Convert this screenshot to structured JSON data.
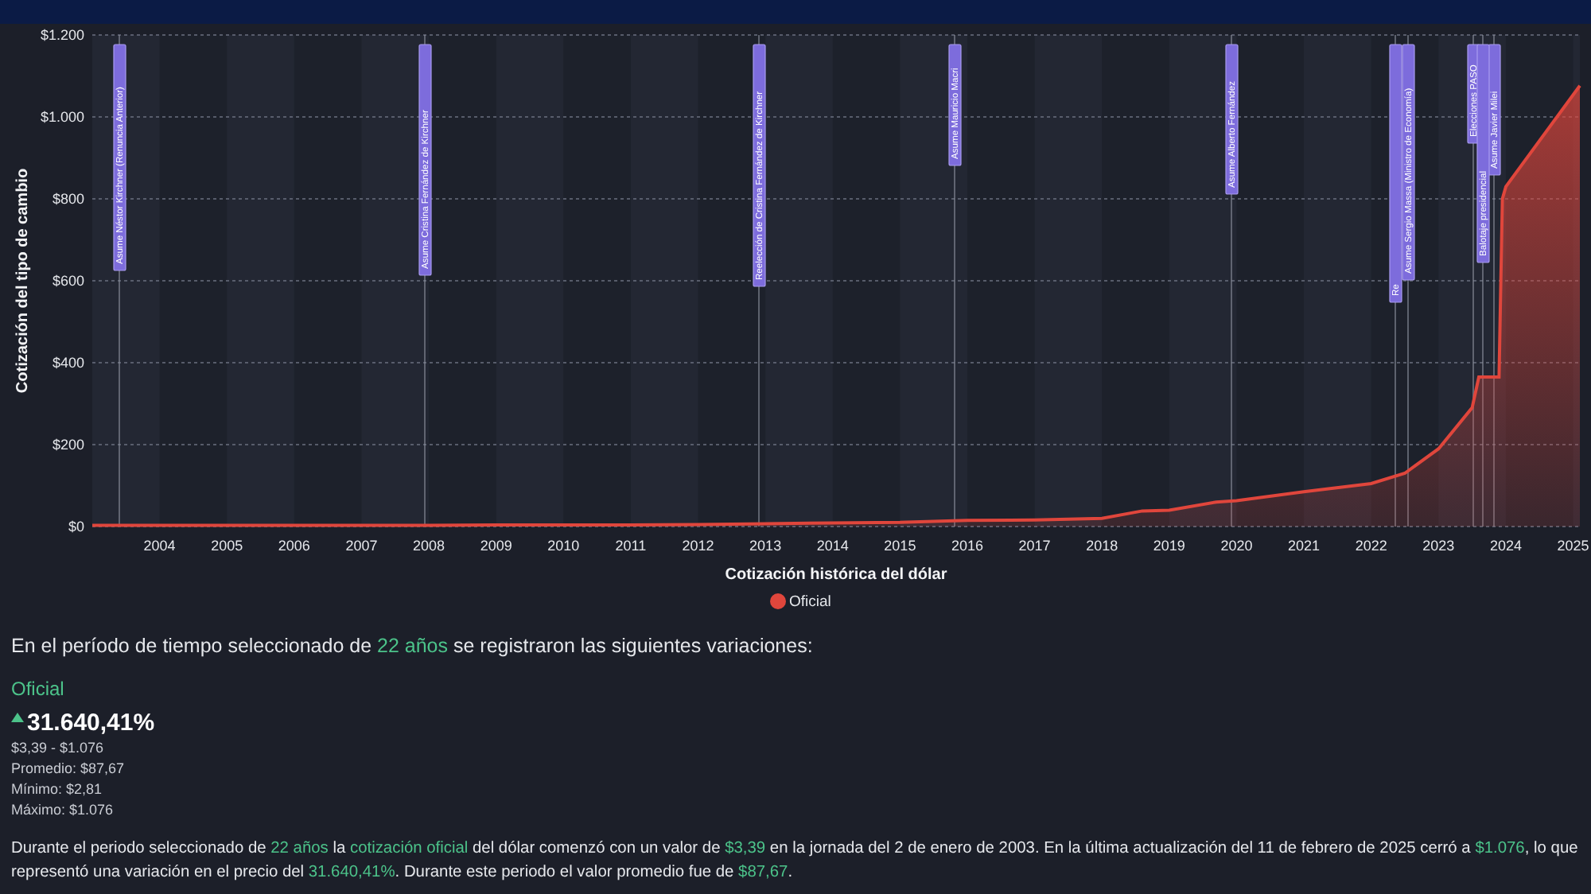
{
  "chart": {
    "chart_data": {
      "type": "area",
      "xlabel": "Cotización histórica del dólar",
      "ylabel": "Cotización del tipo de cambio",
      "x": [
        2003,
        2004,
        2005,
        2006,
        2007,
        2008,
        2009,
        2010,
        2011,
        2012,
        2013,
        2014,
        2015,
        2016,
        2017,
        2018,
        2018.6,
        2019,
        2019.7,
        2020,
        2021,
        2022,
        2022.5,
        2023,
        2023.5,
        2023.6,
        2023.9,
        2023.95,
        2024,
        2025.1
      ],
      "series": [
        {
          "name": "Oficial",
          "color": "#e0463c",
          "values": [
            3,
            3,
            3,
            3,
            3,
            3,
            4,
            4,
            4,
            5,
            7,
            9,
            10,
            15,
            16,
            20,
            38,
            40,
            60,
            63,
            85,
            105,
            130,
            190,
            290,
            365,
            365,
            800,
            830,
            1076
          ]
        }
      ],
      "xlim": [
        2003,
        2025.1
      ],
      "ylim": [
        0,
        1200
      ],
      "grid": true,
      "xticks": [
        2004,
        2005,
        2006,
        2007,
        2008,
        2009,
        2010,
        2011,
        2012,
        2013,
        2014,
        2015,
        2016,
        2017,
        2018,
        2019,
        2020,
        2021,
        2022,
        2023,
        2024,
        2025
      ],
      "yticks": [
        {
          "value": 0,
          "label": "$0"
        },
        {
          "value": 200,
          "label": "$200"
        },
        {
          "value": 400,
          "label": "$400"
        },
        {
          "value": 600,
          "label": "$600"
        },
        {
          "value": 800,
          "label": "$800"
        },
        {
          "value": 1000,
          "label": "$1.000"
        },
        {
          "value": 1200,
          "label": "$1.200"
        }
      ],
      "annotations": [
        "Asume Néstor Kirchner (Renuncia Anterior)",
        "Asume Cristina Fernández de Kirchner",
        "Reelección de Cristina Fernández de Kirchner",
        "Asume Mauricio Macri",
        "Asume Alberto Fernández",
        "Re",
        "Asume Sergio Massa (Ministro de Economía)",
        "Elecciones PASO",
        "Balotaje presidencial",
        "Asume Javier Milei"
      ]
    }
  },
  "summary": {
    "intro": "En el período de tiempo seleccionado de **22 años** se registraron las siguientes variaciones:",
    "series_name": "Oficial",
    "change": "31.640,41%",
    "trend_up": true,
    "details": [
      "$3,39 - $1.076",
      "Promedio: $87,67",
      "Mínimo: $2,81",
      "Máximo: $1.076"
    ],
    "paragraph": "Durante el periodo seleccionado de **22 años** la **cotización oficial** del dólar comenzó con un valor de **$3,39** en la jornada del 2 de enero de 2003. En la última actualización del 11 de febrero de 2025 cerró a **$1.076**, lo que representó una variación en el precio del **31.640,41%**. Durante este periodo el valor promedio fue de **$87,67**."
  }
}
